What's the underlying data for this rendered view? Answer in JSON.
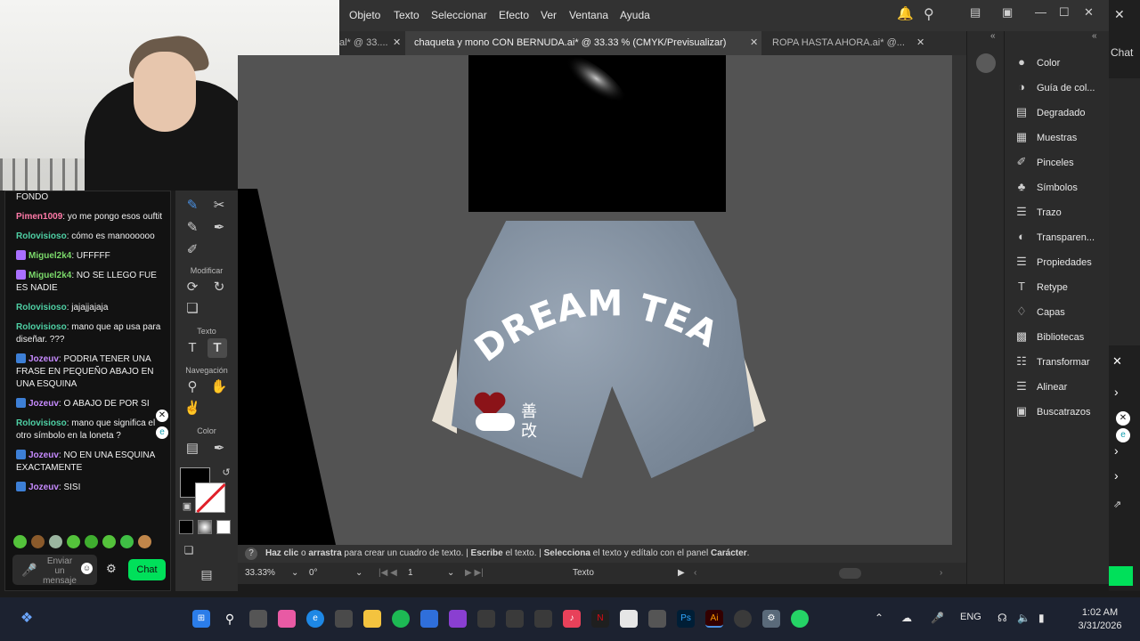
{
  "colors": {
    "illustrator_bg": "#535353",
    "chat_green": "#00e05a",
    "twitch_purple": "#a970ff",
    "short_fabric": "#7c8a9a",
    "heart": "#8b1318"
  },
  "menubar": {
    "items": [
      "Objeto",
      "Texto",
      "Seleccionar",
      "Efecto",
      "Ver",
      "Ventana",
      "Ayuda"
    ]
  },
  "tabs": [
    {
      "label": "al* @ 33....",
      "active": false
    },
    {
      "label": "chaqueta y mono CON BERNUDA.ai* @ 33.33 % (CMYK/Previsualizar)",
      "active": true
    },
    {
      "label": "ROPA HASTA AHORA.ai* @...",
      "active": false
    }
  ],
  "chat": {
    "messages": [
      {
        "user": "",
        "text": "FONDO",
        "color": "#f1f1f1",
        "badge": false
      },
      {
        "user": "Pimen1009",
        "text": "yo me pongo esos ouftit",
        "color": "#ff7aa8",
        "badge": false
      },
      {
        "user": "Rolovisioso",
        "text": "cómo es manoooooo",
        "color": "#4fd1a5",
        "badge": false
      },
      {
        "user": "Miguel2k4",
        "text": "UFFFFF",
        "color": "#7bd96a",
        "badge": true
      },
      {
        "user": "Miguel2k4",
        "text": "NO SE LLEGO FUE ES NADIE",
        "color": "#7bd96a",
        "badge": true
      },
      {
        "user": "Rolovisioso",
        "text": "jajajjajaja",
        "color": "#4fd1a5",
        "badge": false
      },
      {
        "user": "Rolovisioso",
        "text": "mano que ap usa para diseñar. ???",
        "color": "#4fd1a5",
        "badge": false
      },
      {
        "user": "Jozeuv",
        "text": "PODRIA TENER UNA FRASE EN PEQUEÑO ABAJO EN UNA ESQUINA",
        "color": "#c78bff",
        "badge": true
      },
      {
        "user": "Jozeuv",
        "text": "O ABAJO DE POR SI",
        "color": "#c78bff",
        "badge": true
      },
      {
        "user": "Rolovisioso",
        "text": "mano que significa el otro símbolo en la loneta ?",
        "color": "#4fd1a5",
        "badge": false
      },
      {
        "user": "Jozeuv",
        "text": "NO EN UNA ESQUINA EXACTAMENTE",
        "color": "#c78bff",
        "badge": true
      },
      {
        "user": "Jozeuv",
        "text": "SISI",
        "color": "#c78bff",
        "badge": true
      }
    ],
    "input_placeholder": "Enviar un mensaje",
    "send_label": "Chat"
  },
  "tools": {
    "sections": [
      "Modificar",
      "Texto",
      "Navegación",
      "Color"
    ]
  },
  "artwork": {
    "headline": "DREAM TEAM",
    "kanji": "善\n改"
  },
  "hint": {
    "parts": [
      "Haz clic",
      " o ",
      "arrastra",
      " para crear un cuadro de texto.  |  ",
      "Escribe",
      " el texto.  |  ",
      "Selecciona",
      " el texto y edítalo con el panel ",
      "Carácter",
      "."
    ]
  },
  "status": {
    "zoom": "33.33%",
    "rotation": "0°",
    "artboard": "1",
    "tool": "Texto"
  },
  "panels": [
    {
      "label": "Color",
      "icon": "color-icon"
    },
    {
      "label": "Guía de col...",
      "icon": "color-guide-icon"
    },
    {
      "label": "Degradado",
      "icon": "gradient-icon"
    },
    {
      "label": "Muestras",
      "icon": "swatches-icon"
    },
    {
      "label": "Pinceles",
      "icon": "brushes-icon"
    },
    {
      "label": "Símbolos",
      "icon": "symbols-icon"
    },
    {
      "label": "Trazo",
      "icon": "stroke-icon"
    },
    {
      "label": "Transparen...",
      "icon": "transparency-icon"
    },
    {
      "label": "Propiedades",
      "icon": "properties-icon"
    },
    {
      "label": "Retype",
      "icon": "retype-icon"
    },
    {
      "label": "Capas",
      "icon": "layers-icon"
    },
    {
      "label": "Bibliotecas",
      "icon": "libraries-icon"
    },
    {
      "label": "Transformar",
      "icon": "transform-icon"
    },
    {
      "label": "Alinear",
      "icon": "align-icon"
    },
    {
      "label": "Buscatrazos",
      "icon": "pathfinder-icon"
    }
  ],
  "bg_window": {
    "chat_label": "Chat"
  },
  "taskbar": {
    "language": "ENG",
    "time": "1:02 AM",
    "date": "3/31/2026"
  }
}
